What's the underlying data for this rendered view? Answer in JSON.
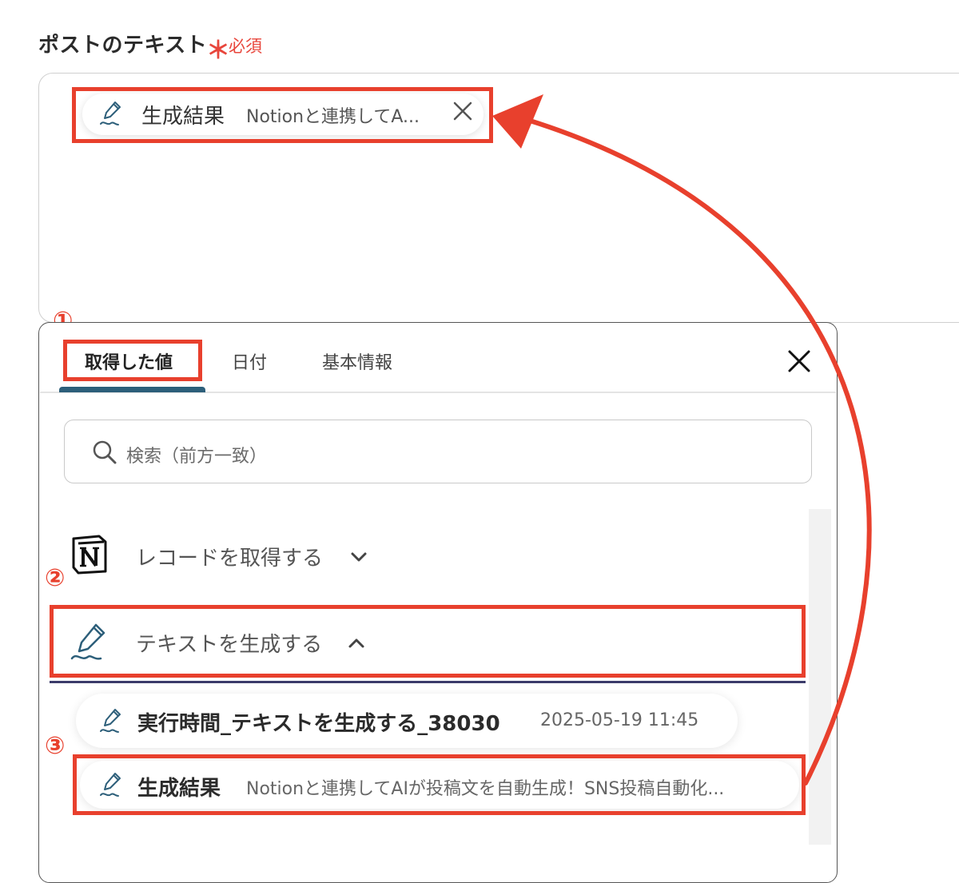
{
  "field": {
    "label": "ポストのテキスト",
    "required_mark": "＊",
    "required_text": "必須"
  },
  "chip": {
    "title": "生成結果",
    "value": "Notionと連携してA..."
  },
  "steps": [
    "①",
    "②",
    "③"
  ],
  "tabs": [
    {
      "label": "取得した値",
      "active": true
    },
    {
      "label": "日付",
      "active": false
    },
    {
      "label": "基本情報",
      "active": false
    }
  ],
  "search": {
    "placeholder": "検索（前方一致）"
  },
  "sections": [
    {
      "title": "レコードを取得する",
      "expanded": false,
      "icon": "notion-icon"
    },
    {
      "title": "テキストを生成する",
      "expanded": true,
      "icon": "pen-icon"
    }
  ],
  "rows": [
    {
      "title": "実行時間_テキストを生成する_38030",
      "sub": "2025-05-19 11:45"
    },
    {
      "title": "生成結果",
      "sub": "Notionと連携してAIが投稿文を自動生成！SNS投稿自動化..."
    }
  ],
  "colors": {
    "highlight": "#e8402d",
    "required": "#e8463c",
    "tab_underline": "#2d5f7a",
    "icon_stroke": "#2d5f7a"
  }
}
